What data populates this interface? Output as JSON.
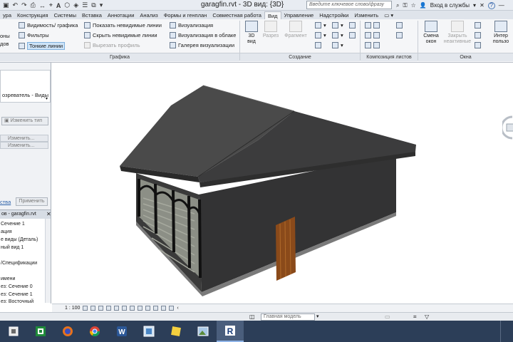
{
  "titlebar": {
    "title": "garagfin.rvt - 3D вид: {3D}",
    "search_placeholder": "Введите ключевое слово/фразу",
    "signin_label": "Вход в службы",
    "help_label": "?"
  },
  "tabs": [
    {
      "label": "ура"
    },
    {
      "label": "Конструкция"
    },
    {
      "label": "Системы"
    },
    {
      "label": "Вставка"
    },
    {
      "label": "Аннотации"
    },
    {
      "label": "Анализ"
    },
    {
      "label": "Формы и генплан"
    },
    {
      "label": "Совместная работа"
    },
    {
      "label": "Вид",
      "active": true
    },
    {
      "label": "Управление"
    },
    {
      "label": "Надстройки"
    },
    {
      "label": "Изменить"
    }
  ],
  "ribbon": {
    "graphics": {
      "label": "Графика",
      "cut_left_top": "оны",
      "cut_left_bottom": "дов",
      "visibility": "Видимость/ графика",
      "filters": "Фильтры",
      "thin_lines": "Тонкие линии",
      "show_hidden": "Показать невидимые линии",
      "hide_hidden": "Скрыть невидимые линии",
      "cut_profile": "Вырезать профиль",
      "render": "Визуализация",
      "render_cloud": "Визуализация в облаке",
      "render_gallery": "Галерея визуализации"
    },
    "create": {
      "label": "Создание",
      "view3d_line1": "3D",
      "view3d_line2": "вид",
      "section": "Разрез",
      "fragment": "Фрагмент"
    },
    "sheets": {
      "label": "Композиция листов"
    },
    "windows": {
      "label": "Окна",
      "switch_line1": "Смена",
      "switch_line2": "окон",
      "close_line1": "Закрыть",
      "close_line2": "неактивные",
      "interface_line1": "Интер",
      "interface_line2": "пользо"
    }
  },
  "properties": {
    "type_line": "озреватель - Виды",
    "edit_type": "Изменить тип",
    "field1": "Изменить...",
    "field2": "Изменить...",
    "link_label": "ства",
    "apply_label": "Применить"
  },
  "browser": {
    "header": "ов - garagfin.rvt",
    "items": [
      "Сечение 1",
      "ация",
      "е виды (Деталь)",
      "ный вид 1",
      "",
      "/Спецификации",
      "",
      "имени",
      "ез: Сечение 0",
      "ез: Сечение 1",
      "ез: Восточный"
    ]
  },
  "viewbar": {
    "scale": "1 : 100"
  },
  "statusbar": {
    "model": "Главная модель"
  },
  "taskbar": {
    "items": [
      "windows-store",
      "spreadsheet",
      "firefox",
      "chrome",
      "word",
      "image-viewer",
      "sticky",
      "photos",
      "revit"
    ]
  }
}
